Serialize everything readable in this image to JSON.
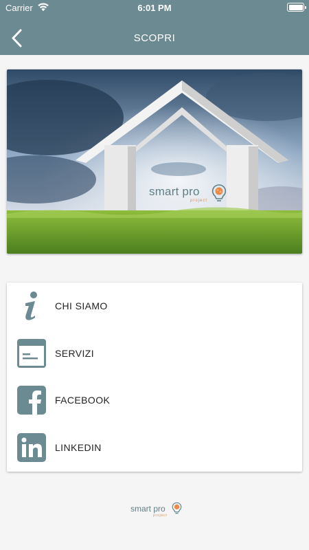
{
  "status_bar": {
    "carrier": "Carrier",
    "time": "6:01 PM"
  },
  "nav": {
    "title": "SCOPRI"
  },
  "hero": {
    "brand": "smart pro",
    "brand_sub": "project"
  },
  "menu": {
    "items": [
      {
        "label": "CHI SIAMO",
        "icon": "info-icon"
      },
      {
        "label": "SERVIZI",
        "icon": "card-icon"
      },
      {
        "label": "FACEBOOK",
        "icon": "facebook-icon"
      },
      {
        "label": "LINKEDIN",
        "icon": "linkedin-icon"
      }
    ]
  },
  "footer": {
    "brand": "smart pro",
    "brand_sub": "project"
  },
  "colors": {
    "accent": "#6c8a91",
    "brand_orange": "#e98a4a",
    "background": "#f5f5f5"
  }
}
